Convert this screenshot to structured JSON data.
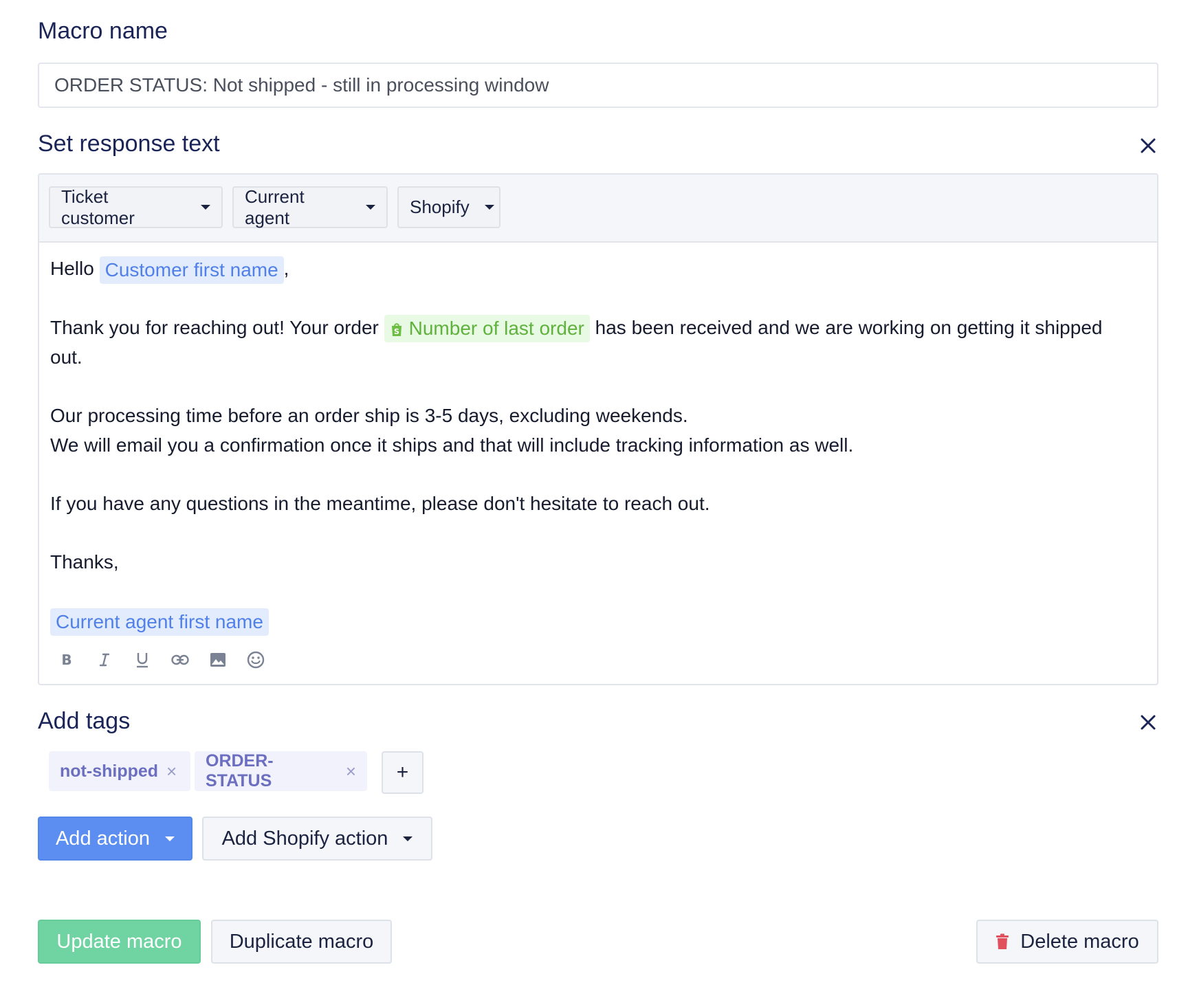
{
  "macro_name": {
    "heading": "Macro name",
    "value": "ORDER STATUS: Not shipped - still in processing window"
  },
  "response_text": {
    "heading": "Set response text",
    "variable_menus": [
      "Ticket customer",
      "Current agent",
      "Shopify"
    ],
    "body": {
      "greeting_prefix": "Hello",
      "customer_first_name_var": "Customer first name",
      "greeting_suffix": ",",
      "line2_prefix": "Thank you for reaching out!  Your order",
      "order_number_var": "Number of last order",
      "line2_suffix": "has been received and we are working on getting it shipped out.",
      "line3": "Our processing time before an order ship is 3-5 days, excluding weekends.",
      "line4": "We will email you a confirmation once it ships and that will include tracking information as well.",
      "line5": "If you have any questions in the meantime, please don't hesitate to reach out.",
      "signoff": "Thanks,",
      "agent_first_name_var": "Current agent first name"
    },
    "format_tools": [
      "bold-icon",
      "italic-icon",
      "underline-icon",
      "link-icon",
      "image-icon",
      "emoji-icon"
    ]
  },
  "tags": {
    "heading": "Add tags",
    "items": [
      "not-shipped",
      "ORDER-STATUS"
    ],
    "remove_glyph": "×",
    "add_glyph": "+"
  },
  "actions": {
    "add_action": "Add action",
    "add_shopify_action": "Add Shopify action"
  },
  "footer": {
    "update": "Update macro",
    "duplicate": "Duplicate macro",
    "delete": "Delete macro"
  },
  "colors": {
    "primary": "#5b8ef0",
    "success": "#6fd3a2",
    "danger": "#e0505d",
    "heading": "#1a2457",
    "variable_blue": "#5080e8",
    "variable_green": "#5fb23c"
  }
}
